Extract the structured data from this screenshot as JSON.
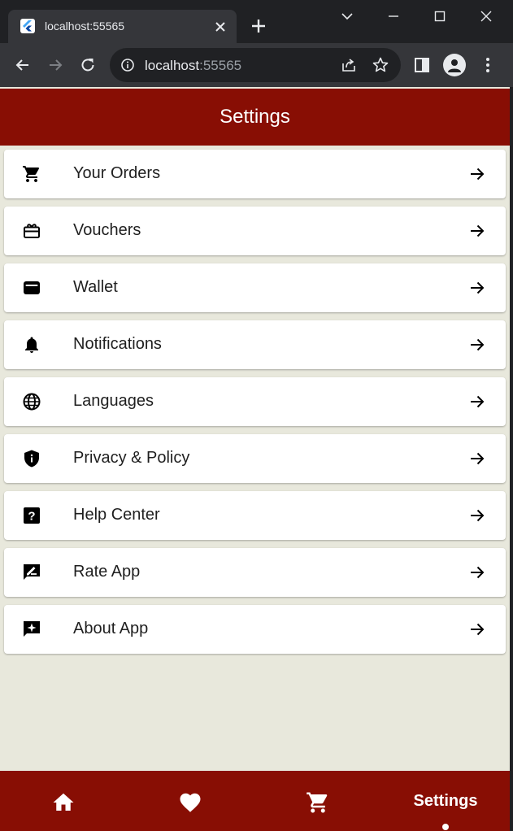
{
  "browser": {
    "tab_title": "localhost:55565",
    "url_host": "localhost",
    "url_port": ":55565"
  },
  "app": {
    "title": "Settings",
    "accent_color": "#880e04",
    "background_color": "#e8e8dc",
    "settings_items": [
      {
        "label": "Your Orders",
        "icon": "shopping-cart-icon"
      },
      {
        "label": "Vouchers",
        "icon": "voucher-icon"
      },
      {
        "label": "Wallet",
        "icon": "wallet-icon"
      },
      {
        "label": "Notifications",
        "icon": "bell-icon"
      },
      {
        "label": "Languages",
        "icon": "globe-icon"
      },
      {
        "label": "Privacy & Policy",
        "icon": "shield-info-icon"
      },
      {
        "label": "Help Center",
        "icon": "help-icon"
      },
      {
        "label": "Rate App",
        "icon": "rate-review-icon"
      },
      {
        "label": "About App",
        "icon": "sparkle-chat-icon"
      }
    ],
    "bottom_nav": {
      "items": [
        {
          "icon": "home-icon"
        },
        {
          "icon": "heart-icon"
        },
        {
          "icon": "shopping-cart-icon"
        },
        {
          "label": "Settings",
          "active": true
        }
      ]
    }
  }
}
